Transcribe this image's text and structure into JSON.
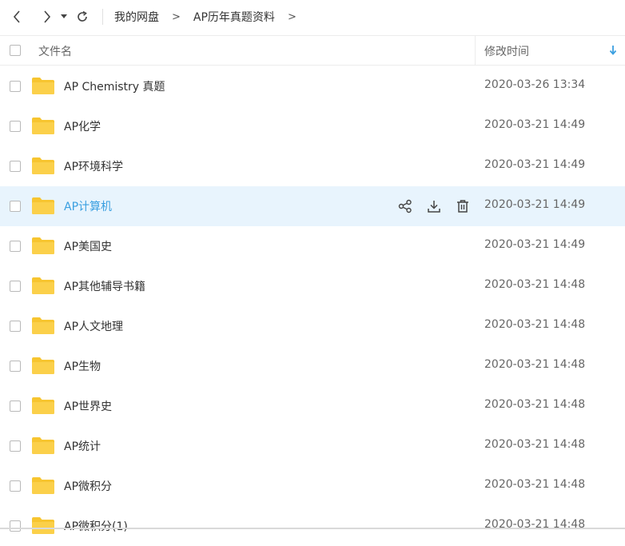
{
  "breadcrumb": {
    "root": "我的网盘",
    "sep1": ">",
    "current": "AP历年真题资料",
    "sep2": ">"
  },
  "header": {
    "name_label": "文件名",
    "time_label": "修改时间"
  },
  "icons": {
    "back": "chevron-left-icon",
    "forward": "chevron-right-icon",
    "dropdown": "caret-down-icon",
    "refresh": "refresh-icon",
    "folder": "folder-icon",
    "share": "share-icon",
    "download": "download-icon",
    "delete": "trash-icon",
    "sort": "arrow-down-icon"
  },
  "colors": {
    "folder": "#f7c530",
    "hover_bg": "#e8f4fd",
    "accent": "#3a9fe0"
  },
  "rows": [
    {
      "name": "AP Chemistry 真题",
      "time": "2020-03-26 13:34"
    },
    {
      "name": "AP化学",
      "time": "2020-03-21 14:49"
    },
    {
      "name": "AP环境科学",
      "time": "2020-03-21 14:49"
    },
    {
      "name": "AP计算机",
      "time": "2020-03-21 14:49"
    },
    {
      "name": "AP美国史",
      "time": "2020-03-21 14:49"
    },
    {
      "name": "AP其他辅导书籍",
      "time": "2020-03-21 14:48"
    },
    {
      "name": "AP人文地理",
      "time": "2020-03-21 14:48"
    },
    {
      "name": "AP生物",
      "time": "2020-03-21 14:48"
    },
    {
      "name": "AP世界史",
      "time": "2020-03-21 14:48"
    },
    {
      "name": "AP统计",
      "time": "2020-03-21 14:48"
    },
    {
      "name": "AP微积分",
      "time": "2020-03-21 14:48"
    },
    {
      "name": "AP微积分(1)",
      "time": "2020-03-21 14:48"
    }
  ]
}
